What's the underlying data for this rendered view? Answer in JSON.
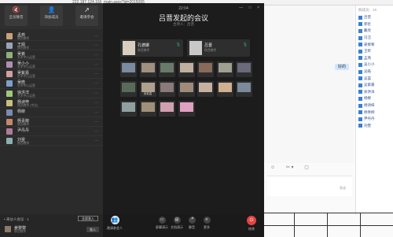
{
  "browser": {
    "url": "222.187.124.16/j_main.aspx?id=2015065"
  },
  "meeting": {
    "time": "22:04",
    "title": "吕晋发起的会议",
    "host": "主持人：吕晋",
    "window_controls": "— □ ×",
    "top_buttons": [
      {
        "label": "全员静音",
        "icon": "🔇"
      },
      {
        "label": "添加成员",
        "icon": "👤"
      },
      {
        "label": "邀请参会",
        "icon": "↗"
      }
    ],
    "participants": [
      {
        "name": "孟燕",
        "sub": "陕西教师",
        "color": "#c8a07a"
      },
      {
        "name": "王娟",
        "sub": "陕西教师",
        "color": "#9aa4b8"
      },
      {
        "name": "吴荟",
        "sub": "艺术中心运营",
        "color": "#8fb07a"
      },
      {
        "name": "吴小小",
        "sub": "艺术中心运营",
        "color": "#b08fb0"
      },
      {
        "name": "吴紫嘉",
        "sub": "艺术中心运营",
        "color": "#d0a0a0"
      },
      {
        "name": "吴皓",
        "sub": "艺术中心运营",
        "color": "#7aa0c8"
      },
      {
        "name": "徐洪洋",
        "sub": "艺术中心运营",
        "color": "#a0c87a"
      },
      {
        "name": "杨诗梓",
        "sub": "陕西教师 (专业)",
        "color": "#c8c07a"
      },
      {
        "name": "杨柳",
        "sub": "",
        "color": "#7a8ab0"
      },
      {
        "name": "杨青柳",
        "sub": "陕西教师",
        "color": "#c08a6a"
      },
      {
        "name": "尹丹丹",
        "sub": "",
        "color": "#b07a9a"
      },
      {
        "name": "刘雯",
        "sub": "陕西教师",
        "color": "#8ab0b0"
      }
    ],
    "more_label": "···",
    "waiting": {
      "label": "• 来访人会议 · 1",
      "admit_all": "全部准入",
      "name": "姜黎黎",
      "sub": "陕西教师",
      "admit": "准入"
    },
    "big_tiles": [
      {
        "name": "孔德娜",
        "sub": "陕西教师",
        "mic": "🎙",
        "color": "#d9cfc0"
      },
      {
        "name": "吕晋",
        "sub": "陕西教师",
        "mic": "🎙",
        "color": "#c8c8c8"
      }
    ],
    "tiles": [
      {
        "label": "",
        "color": "#7a8aa0"
      },
      {
        "label": "",
        "color": "#a09080"
      },
      {
        "label": "",
        "color": "#6a7a6a"
      },
      {
        "label": "",
        "color": "#c0b0a0"
      },
      {
        "label": "",
        "color": "#8a6a5a"
      },
      {
        "label": "",
        "color": "#a0a090"
      },
      {
        "label": "",
        "color": "#6a6a7a"
      },
      {
        "label": "",
        "color": "#5a6a5a"
      },
      {
        "label": "吴紫嘉",
        "color": "#b0a090"
      },
      {
        "label": "",
        "color": "#8a7a7a"
      },
      {
        "label": "",
        "color": "#a08a7a"
      },
      {
        "label": "",
        "color": "#c8b0a0"
      },
      {
        "label": "",
        "color": "#d0b090"
      },
      {
        "label": "",
        "color": "#7a8a9a"
      },
      {
        "label": "",
        "color": "#90a0a0"
      },
      {
        "label": "",
        "color": "#a0907a"
      },
      {
        "label": "",
        "color": "#d0a0b0"
      },
      {
        "label": "",
        "color": "#e0a0c0"
      }
    ],
    "bottom": {
      "invite": "邀请参会人",
      "invite_icon": "👥",
      "controls": [
        {
          "label": "屏幕演示",
          "icon": "▭"
        },
        {
          "label": "文档演示",
          "icon": "▤"
        },
        {
          "label": "静音",
          "icon": "🎤"
        },
        {
          "label": "更多",
          "icon": "≡"
        }
      ],
      "end": "结束",
      "end_icon": "⏻"
    }
  },
  "side_chat": {
    "bubble": "好的",
    "tools": [
      "☺",
      "✂ ▾",
      "▢"
    ],
    "send_hint": "发送",
    "member_title": "群成员：19",
    "members": [
      "吕晋",
      "郭伦",
      "戴亮",
      "冯洁",
      "姜黎黎",
      "王昕",
      "孟燕",
      "吴小小",
      "吴皓",
      "吴荟",
      "吴紫嘉",
      "徐洪洋",
      "杨柳",
      "杨诗梓",
      "杨青柳",
      "尹丹丹",
      "刘雯"
    ]
  }
}
